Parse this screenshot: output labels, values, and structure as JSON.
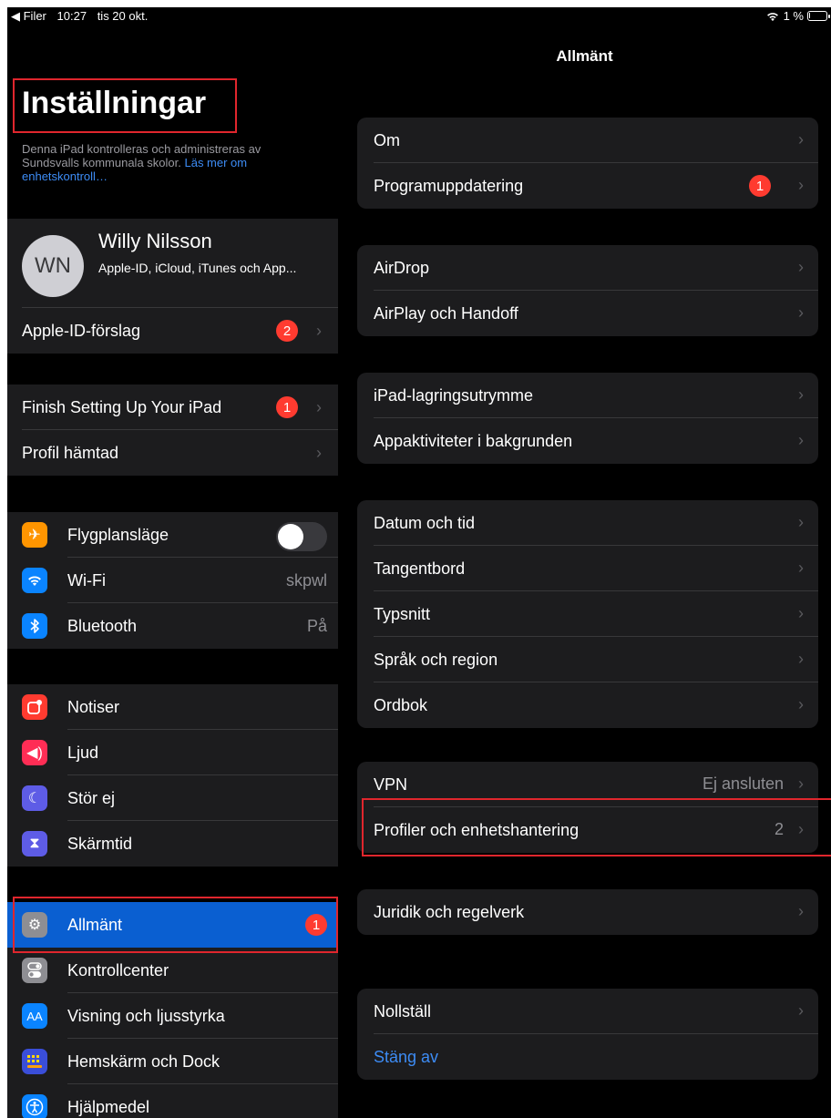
{
  "status": {
    "back_app": "◀ Filer",
    "time": "10:27",
    "date": "tis 20 okt.",
    "battery": "1 %",
    "battery_level": 0.01
  },
  "sidebar": {
    "title": "Inställningar",
    "mgmt_text": "Denna iPad kontrolleras och administreras av Sundsvalls kommunala skolor.",
    "mgmt_link": "Läs mer om enhetskontroll…",
    "profile": {
      "initials": "WN",
      "name": "Willy Nilsson",
      "subtitle": "Apple-ID, iCloud, iTunes och App..."
    },
    "apple_id_suggestions": {
      "label": "Apple-ID-förslag",
      "badge": "2"
    },
    "finish_setup": {
      "label": "Finish Setting Up Your iPad",
      "badge": "1"
    },
    "profile_loaded": {
      "label": "Profil hämtad"
    },
    "connectivity": [
      {
        "label": "Flygplansläge",
        "icon": "airplane-icon",
        "color": "#ff9500",
        "toggle": false
      },
      {
        "label": "Wi-Fi",
        "icon": "wifi-icon",
        "color": "#0a84ff",
        "value": "skpwl"
      },
      {
        "label": "Bluetooth",
        "icon": "bluetooth-icon",
        "color": "#0a84ff",
        "value": "På"
      }
    ],
    "alerts": [
      {
        "label": "Notiser",
        "icon": "notifications-icon",
        "color": "#ff3b30"
      },
      {
        "label": "Ljud",
        "icon": "speaker-icon",
        "color": "#ff2d55"
      },
      {
        "label": "Stör ej",
        "icon": "moon-icon",
        "color": "#5e5ce6"
      },
      {
        "label": "Skärmtid",
        "icon": "hourglass-icon",
        "color": "#5e5ce6"
      }
    ],
    "general": [
      {
        "label": "Allmänt",
        "icon": "gear-icon",
        "color": "#8e8e93",
        "badge": "1",
        "selected": true
      },
      {
        "label": "Kontrollcenter",
        "icon": "toggles-icon",
        "color": "#8e8e93"
      },
      {
        "label": "Visning och ljusstyrka",
        "icon": "text-size-icon",
        "color": "#0a84ff"
      },
      {
        "label": "Hemskärm och Dock",
        "icon": "home-grid-icon",
        "color": "#3a4ed9"
      },
      {
        "label": "Hjälpmedel",
        "icon": "accessibility-icon",
        "color": "#0a84ff"
      }
    ]
  },
  "detail": {
    "title": "Allmänt",
    "groups": [
      [
        {
          "label": "Om"
        },
        {
          "label": "Programuppdatering",
          "badge": "1"
        }
      ],
      [
        {
          "label": "AirDrop"
        },
        {
          "label": "AirPlay och Handoff"
        }
      ],
      [
        {
          "label": "iPad-lagringsutrymme"
        },
        {
          "label": "Appaktiviteter i bakgrunden"
        }
      ],
      [
        {
          "label": "Datum och tid"
        },
        {
          "label": "Tangentbord"
        },
        {
          "label": "Typsnitt"
        },
        {
          "label": "Språk och region"
        },
        {
          "label": "Ordbok"
        }
      ],
      [
        {
          "label": "VPN",
          "value": "Ej ansluten"
        },
        {
          "label": "Profiler och enhetshantering",
          "value": "2"
        }
      ],
      [
        {
          "label": "Juridik och regelverk"
        }
      ],
      [
        {
          "label": "Nollställ"
        },
        {
          "label": "Stäng av",
          "link": true
        }
      ]
    ]
  }
}
